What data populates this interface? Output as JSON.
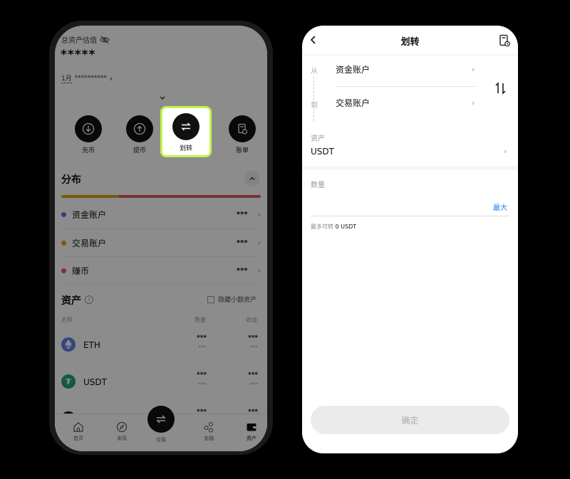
{
  "left": {
    "total_label": "总资产估值",
    "total_value": "*****",
    "month_label": "1月",
    "month_value": "**********",
    "actions": [
      {
        "label": "充币",
        "icon": "deposit-icon"
      },
      {
        "label": "提币",
        "icon": "withdraw-icon"
      },
      {
        "label": "划转",
        "icon": "transfer-icon"
      },
      {
        "label": "账单",
        "icon": "bill-icon"
      }
    ],
    "distribution": {
      "title": "分布",
      "bar_colors": [
        "#d9a21a",
        "#e05a5a"
      ],
      "bar_fractions": [
        0.29,
        0.71
      ],
      "accounts": [
        {
          "name": "资金账户",
          "value": "***",
          "dot": "#6c6ce0"
        },
        {
          "name": "交易账户",
          "value": "***",
          "dot": "#e0a020"
        },
        {
          "name": "赚币",
          "value": "***",
          "dot": "#e05a6a"
        }
      ]
    },
    "assets": {
      "title": "资产",
      "hide_small_label": "隐藏小额资产",
      "col_name": "名称",
      "col_qty": "数量",
      "col_income": "收益",
      "rows": [
        {
          "name": "ETH",
          "qty": "***",
          "qty_sub": "***",
          "income": "***",
          "income_sub": "***",
          "color": "#627eea",
          "icon": "eth-icon"
        },
        {
          "name": "USDT",
          "qty": "***",
          "qty_sub": "***",
          "income": "***",
          "income_sub": "***",
          "color": "#26a17b",
          "icon": "usdt-icon"
        },
        {
          "name": "",
          "qty": "***",
          "qty_sub": "",
          "income": "***",
          "income_sub": "",
          "color": "#111111",
          "icon": "coin-icon"
        }
      ]
    },
    "nav": [
      {
        "label": "首页",
        "icon": "home-icon"
      },
      {
        "label": "发现",
        "icon": "discover-icon"
      },
      {
        "label": "交易",
        "icon": "trade-icon"
      },
      {
        "label": "金融",
        "icon": "finance-icon"
      },
      {
        "label": "资产",
        "icon": "wallet-icon"
      }
    ],
    "highlight_color": "#c6f24b"
  },
  "right": {
    "title": "划转",
    "from_label": "从",
    "to_label": "到",
    "from_account": "资金账户",
    "to_account": "交易账户",
    "asset_label": "资产",
    "asset_value": "USDT",
    "qty_label": "数量",
    "max_label": "最大",
    "max_transfer_label": "最多可转",
    "max_transfer_value": "0 USDT",
    "confirm_label": "确定",
    "accent": "#1a7ef0"
  }
}
